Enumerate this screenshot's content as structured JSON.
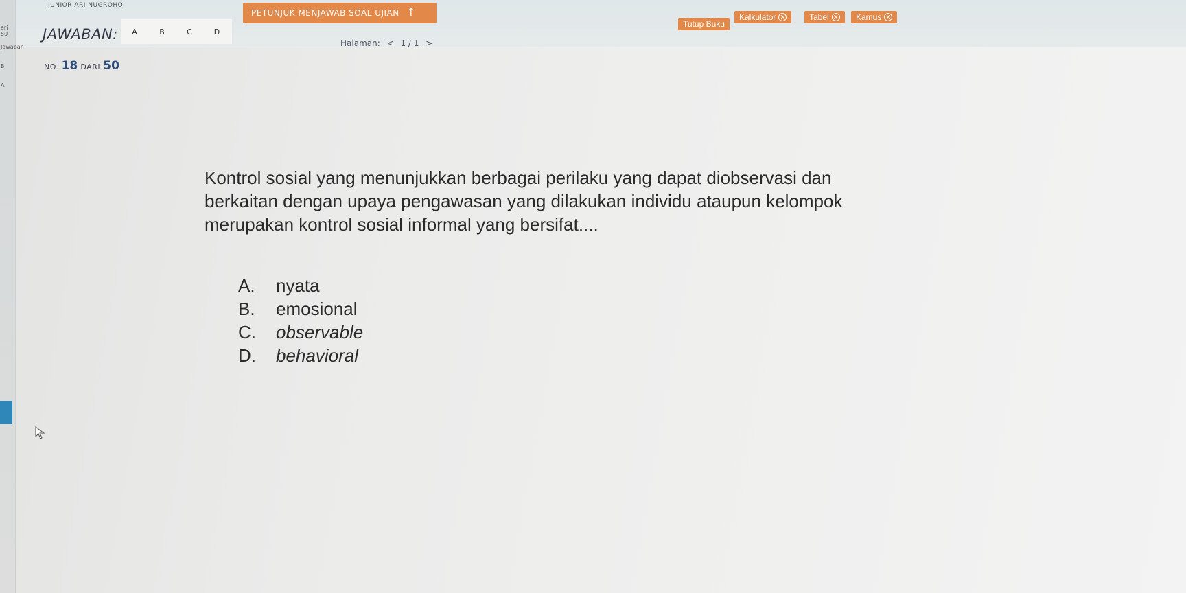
{
  "header": {
    "user_name": "JUNIOR ARI NUGROHO",
    "answer_label": "JAWABAN:",
    "answer_options": [
      "A",
      "B",
      "C",
      "D"
    ],
    "instructions_button": "PETUNJUK MENJAWAB SOAL UJIAN",
    "page_label": "Halaman:",
    "page_prev": "<",
    "page_value": "1 / 1",
    "page_next": ">",
    "tools": {
      "close_book": "Tutup Buku",
      "calculator": "Kalkulator",
      "table": "Tabel",
      "dictionary": "Kamus"
    },
    "accent_color": "#e2894a"
  },
  "sidebar": {
    "labels": [
      "ari 50",
      "Jawaban",
      "B",
      "A"
    ]
  },
  "question": {
    "no_label": "NO.",
    "number": "18",
    "of_label": "DARI",
    "total": "50",
    "lines": [
      "Kontrol sosial yang menunjukkan berbagai perilaku yang dapat diobservasi dan",
      "berkaitan dengan upaya pengawasan yang dilakukan individu ataupun kelompok",
      "merupakan kontrol sosial informal yang bersifat...."
    ],
    "options": [
      {
        "letter": "A.",
        "text": "nyata"
      },
      {
        "letter": "B.",
        "text": "emosional"
      },
      {
        "letter": "C.",
        "text": "observable"
      },
      {
        "letter": "D.",
        "text": "behavioral"
      }
    ]
  }
}
